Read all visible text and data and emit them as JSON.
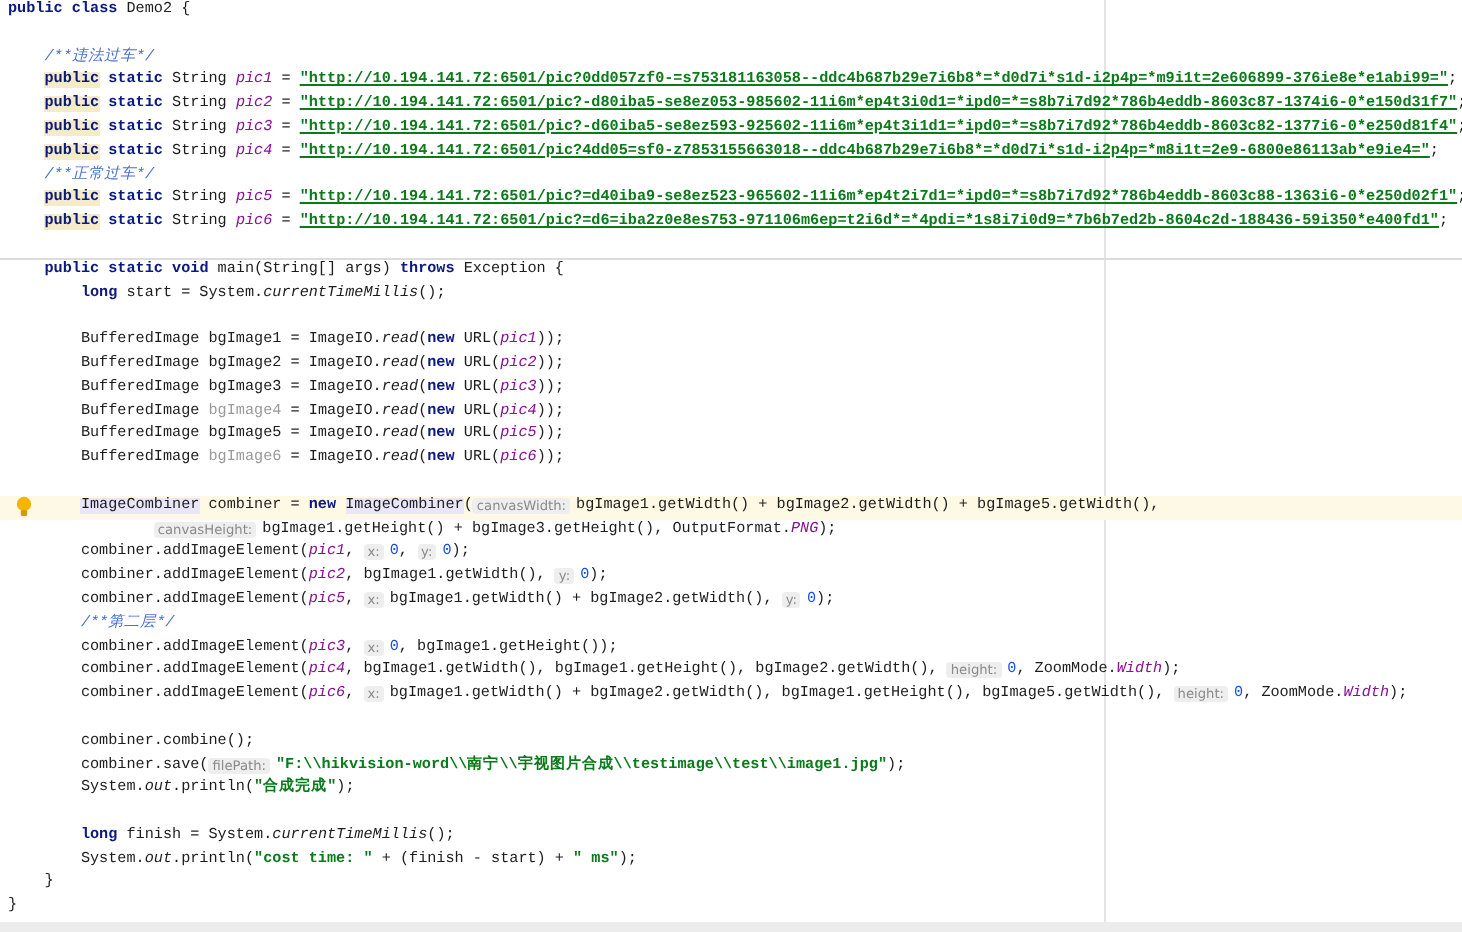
{
  "editor": {
    "lines": [
      {
        "kind": "code",
        "tokens": [
          {
            "kind": "kw",
            "text": "public class"
          },
          {
            "kind": "plain",
            "text": " Demo2 {"
          }
        ],
        "children": [
          {
            "kind": "blank"
          },
          {
            "kind": "code",
            "tokens": [
              {
                "kind": "comment",
                "text": "/**违法过车*/"
              }
            ]
          },
          {
            "kind": "code",
            "tokens": [
              {
                "kind": "kw_warn",
                "text": "public"
              },
              {
                "kind": "kw",
                "text": " static"
              },
              {
                "kind": "plain",
                "text": " String "
              },
              {
                "kind": "field",
                "text": "pic1"
              },
              {
                "kind": "plain",
                "text": " = "
              },
              {
                "kind": "url",
                "text": "\"http://10.194.141.72:6501/pic?0dd057zf0-=s753181163058--ddc4b687b29e7i6b8*=*d0d7i*s1d-i2p4p=*m9i1t=2e606899-376ie8e*e1abi99=\""
              },
              {
                "kind": "plain",
                "text": ";"
              }
            ]
          },
          {
            "kind": "code",
            "tokens": [
              {
                "kind": "kw_warn",
                "text": "public"
              },
              {
                "kind": "kw",
                "text": " static"
              },
              {
                "kind": "plain",
                "text": " String "
              },
              {
                "kind": "field",
                "text": "pic2"
              },
              {
                "kind": "plain",
                "text": " = "
              },
              {
                "kind": "url",
                "text": "\"http://10.194.141.72:6501/pic?-d80iba5-se8ez053-985602-11i6m*ep4t3i0d1=*ipd0=*=s8b7i7d92*786b4eddb-8603c87-1374i6-0*e150d31f7\""
              },
              {
                "kind": "plain",
                "text": ";"
              }
            ]
          },
          {
            "kind": "code",
            "tokens": [
              {
                "kind": "kw_warn",
                "text": "public"
              },
              {
                "kind": "kw",
                "text": " static"
              },
              {
                "kind": "plain",
                "text": " String "
              },
              {
                "kind": "field",
                "text": "pic3"
              },
              {
                "kind": "plain",
                "text": " = "
              },
              {
                "kind": "url",
                "text": "\"http://10.194.141.72:6501/pic?-d60iba5-se8ez593-925602-11i6m*ep4t3i1d1=*ipd0=*=s8b7i7d92*786b4eddb-8603c82-1377i6-0*e250d81f4\""
              },
              {
                "kind": "plain",
                "text": ";"
              }
            ]
          },
          {
            "kind": "code",
            "tokens": [
              {
                "kind": "kw_warn",
                "text": "public"
              },
              {
                "kind": "kw",
                "text": " static"
              },
              {
                "kind": "plain",
                "text": " String "
              },
              {
                "kind": "field",
                "text": "pic4"
              },
              {
                "kind": "plain",
                "text": " = "
              },
              {
                "kind": "url",
                "text": "\"http://10.194.141.72:6501/pic?4dd05=sf0-z7853155663018--ddc4b687b29e7i6b8*=*d0d7i*s1d-i2p4p=*m8i1t=2e9-6800e86113ab*e9ie4=\""
              },
              {
                "kind": "plain",
                "text": ";"
              }
            ]
          },
          {
            "kind": "code",
            "tokens": [
              {
                "kind": "comment",
                "text": "/**正常过车*/"
              }
            ]
          },
          {
            "kind": "code",
            "tokens": [
              {
                "kind": "kw_warn",
                "text": "public"
              },
              {
                "kind": "kw",
                "text": " static"
              },
              {
                "kind": "plain",
                "text": " String "
              },
              {
                "kind": "field",
                "text": "pic5"
              },
              {
                "kind": "plain",
                "text": " = "
              },
              {
                "kind": "url",
                "text": "\"http://10.194.141.72:6501/pic?=d40iba9-se8ez523-965602-11i6m*ep4t2i7d1=*ipd0=*=s8b7i7d92*786b4eddb-8603c88-1363i6-0*e250d02f1\""
              },
              {
                "kind": "plain",
                "text": ";"
              }
            ]
          },
          {
            "kind": "code",
            "tokens": [
              {
                "kind": "kw_warn",
                "text": "public"
              },
              {
                "kind": "kw",
                "text": " static"
              },
              {
                "kind": "plain",
                "text": " String "
              },
              {
                "kind": "field",
                "text": "pic6"
              },
              {
                "kind": "plain",
                "text": " = "
              },
              {
                "kind": "url",
                "text": "\"http://10.194.141.72:6501/pic?=d6=iba2z0e8es753-971106m6ep=t2i6d*=*4pdi=*1s8i7i0d9=*7b6b7ed2b-8604c2d-188436-59i350*e400fd1\""
              },
              {
                "kind": "plain",
                "text": ";"
              }
            ]
          },
          {
            "kind": "blank"
          },
          {
            "kind": "method",
            "tokens": [
              {
                "kind": "kw",
                "text": "public static void"
              },
              {
                "kind": "plain",
                "text": " main(String[] args) "
              },
              {
                "kind": "kw",
                "text": "throws"
              },
              {
                "kind": "plain",
                "text": " Exception {"
              }
            ],
            "children": [
              {
                "kind": "code",
                "tokens": [
                  {
                    "kind": "kw",
                    "text": "long"
                  },
                  {
                    "kind": "plain",
                    "text": " start = System."
                  },
                  {
                    "kind": "static",
                    "text": "currentTimeMillis"
                  },
                  {
                    "kind": "plain",
                    "text": "();"
                  }
                ]
              },
              {
                "kind": "blank"
              },
              {
                "kind": "code",
                "tokens": [
                  {
                    "kind": "plain",
                    "text": "BufferedImage bgImage1 = ImageIO."
                  },
                  {
                    "kind": "static",
                    "text": "read"
                  },
                  {
                    "kind": "plain",
                    "text": "("
                  },
                  {
                    "kind": "kw",
                    "text": "new"
                  },
                  {
                    "kind": "plain",
                    "text": " URL("
                  },
                  {
                    "kind": "field",
                    "text": "pic1"
                  },
                  {
                    "kind": "plain",
                    "text": "));"
                  }
                ]
              },
              {
                "kind": "code",
                "tokens": [
                  {
                    "kind": "plain",
                    "text": "BufferedImage bgImage2 = ImageIO."
                  },
                  {
                    "kind": "static",
                    "text": "read"
                  },
                  {
                    "kind": "plain",
                    "text": "("
                  },
                  {
                    "kind": "kw",
                    "text": "new"
                  },
                  {
                    "kind": "plain",
                    "text": " URL("
                  },
                  {
                    "kind": "field",
                    "text": "pic2"
                  },
                  {
                    "kind": "plain",
                    "text": "));"
                  }
                ]
              },
              {
                "kind": "code",
                "tokens": [
                  {
                    "kind": "plain",
                    "text": "BufferedImage bgImage3 = ImageIO."
                  },
                  {
                    "kind": "static",
                    "text": "read"
                  },
                  {
                    "kind": "plain",
                    "text": "("
                  },
                  {
                    "kind": "kw",
                    "text": "new"
                  },
                  {
                    "kind": "plain",
                    "text": " URL("
                  },
                  {
                    "kind": "field",
                    "text": "pic3"
                  },
                  {
                    "kind": "plain",
                    "text": "));"
                  }
                ]
              },
              {
                "kind": "code",
                "tokens": [
                  {
                    "kind": "plain",
                    "text": "BufferedImage "
                  },
                  {
                    "kind": "unused",
                    "text": "bgImage4"
                  },
                  {
                    "kind": "plain",
                    "text": " = ImageIO."
                  },
                  {
                    "kind": "static",
                    "text": "read"
                  },
                  {
                    "kind": "plain",
                    "text": "("
                  },
                  {
                    "kind": "kw",
                    "text": "new"
                  },
                  {
                    "kind": "plain",
                    "text": " URL("
                  },
                  {
                    "kind": "field",
                    "text": "pic4"
                  },
                  {
                    "kind": "plain",
                    "text": "));"
                  }
                ]
              },
              {
                "kind": "code",
                "tokens": [
                  {
                    "kind": "plain",
                    "text": "BufferedImage bgImage5 = ImageIO."
                  },
                  {
                    "kind": "static",
                    "text": "read"
                  },
                  {
                    "kind": "plain",
                    "text": "("
                  },
                  {
                    "kind": "kw",
                    "text": "new"
                  },
                  {
                    "kind": "plain",
                    "text": " URL("
                  },
                  {
                    "kind": "field",
                    "text": "pic5"
                  },
                  {
                    "kind": "plain",
                    "text": "));"
                  }
                ]
              },
              {
                "kind": "code",
                "tokens": [
                  {
                    "kind": "plain",
                    "text": "BufferedImage "
                  },
                  {
                    "kind": "unused",
                    "text": "bgImage6"
                  },
                  {
                    "kind": "plain",
                    "text": " = ImageIO."
                  },
                  {
                    "kind": "static",
                    "text": "read"
                  },
                  {
                    "kind": "plain",
                    "text": "("
                  },
                  {
                    "kind": "kw",
                    "text": "new"
                  },
                  {
                    "kind": "plain",
                    "text": " URL("
                  },
                  {
                    "kind": "field",
                    "text": "pic6"
                  },
                  {
                    "kind": "plain",
                    "text": "));"
                  }
                ]
              },
              {
                "kind": "blank"
              },
              {
                "kind": "current",
                "tokens": [
                  {
                    "kind": "usage",
                    "text": "ImageCombiner"
                  },
                  {
                    "kind": "plain",
                    "text": " combiner = "
                  },
                  {
                    "kind": "kw",
                    "text": "new "
                  },
                  {
                    "kind": "usage",
                    "text": "ImageCombiner"
                  },
                  {
                    "kind": "plain",
                    "text": "("
                  },
                  {
                    "kind": "hint",
                    "text": "canvasWidth:"
                  },
                  {
                    "kind": "plain",
                    "text": "bgImage1.getWidth() + bgImage2.getWidth() + bgImage5.getWidth(),"
                  }
                ]
              },
              {
                "kind": "continuation",
                "tokens": [
                  {
                    "kind": "hint",
                    "text": "canvasHeight:"
                  },
                  {
                    "kind": "plain",
                    "text": "bgImage1.getHeight() + bgImage3.getHeight(), OutputFormat."
                  },
                  {
                    "kind": "field",
                    "text": "PNG"
                  },
                  {
                    "kind": "plain",
                    "text": ");"
                  }
                ]
              },
              {
                "kind": "code",
                "tokens": [
                  {
                    "kind": "plain",
                    "text": "combiner.addImageElement("
                  },
                  {
                    "kind": "field",
                    "text": "pic1"
                  },
                  {
                    "kind": "plain",
                    "text": ", "
                  },
                  {
                    "kind": "hint",
                    "text": "x:"
                  },
                  {
                    "kind": "num",
                    "text": "0"
                  },
                  {
                    "kind": "plain",
                    "text": ", "
                  },
                  {
                    "kind": "hint",
                    "text": "y:"
                  },
                  {
                    "kind": "num",
                    "text": "0"
                  },
                  {
                    "kind": "plain",
                    "text": ");"
                  }
                ]
              },
              {
                "kind": "code",
                "tokens": [
                  {
                    "kind": "plain",
                    "text": "combiner.addImageElement("
                  },
                  {
                    "kind": "field",
                    "text": "pic2"
                  },
                  {
                    "kind": "plain",
                    "text": ", bgImage1.getWidth(), "
                  },
                  {
                    "kind": "hint",
                    "text": "y:"
                  },
                  {
                    "kind": "num",
                    "text": "0"
                  },
                  {
                    "kind": "plain",
                    "text": ");"
                  }
                ]
              },
              {
                "kind": "code",
                "tokens": [
                  {
                    "kind": "plain",
                    "text": "combiner.addImageElement("
                  },
                  {
                    "kind": "field",
                    "text": "pic5"
                  },
                  {
                    "kind": "plain",
                    "text": ", "
                  },
                  {
                    "kind": "hint",
                    "text": "x:"
                  },
                  {
                    "kind": "plain",
                    "text": "bgImage1.getWidth() + bgImage2.getWidth(), "
                  },
                  {
                    "kind": "hint",
                    "text": "y:"
                  },
                  {
                    "kind": "num",
                    "text": "0"
                  },
                  {
                    "kind": "plain",
                    "text": ");"
                  }
                ]
              },
              {
                "kind": "code",
                "tokens": [
                  {
                    "kind": "comment",
                    "text": "/**第二层*/"
                  }
                ]
              },
              {
                "kind": "code",
                "tokens": [
                  {
                    "kind": "plain",
                    "text": "combiner.addImageElement("
                  },
                  {
                    "kind": "field",
                    "text": "pic3"
                  },
                  {
                    "kind": "plain",
                    "text": ", "
                  },
                  {
                    "kind": "hint",
                    "text": "x:"
                  },
                  {
                    "kind": "num",
                    "text": "0"
                  },
                  {
                    "kind": "plain",
                    "text": ", bgImage1.getHeight());"
                  }
                ]
              },
              {
                "kind": "code",
                "tokens": [
                  {
                    "kind": "plain",
                    "text": "combiner.addImageElement("
                  },
                  {
                    "kind": "field",
                    "text": "pic4"
                  },
                  {
                    "kind": "plain",
                    "text": ", bgImage1.getWidth(), bgImage1.getHeight(), bgImage2.getWidth(), "
                  },
                  {
                    "kind": "hint",
                    "text": "height:"
                  },
                  {
                    "kind": "num",
                    "text": "0"
                  },
                  {
                    "kind": "plain",
                    "text": ", ZoomMode."
                  },
                  {
                    "kind": "field",
                    "text": "Width"
                  },
                  {
                    "kind": "plain",
                    "text": ");"
                  }
                ]
              },
              {
                "kind": "code",
                "tokens": [
                  {
                    "kind": "plain",
                    "text": "combiner.addImageElement("
                  },
                  {
                    "kind": "field",
                    "text": "pic6"
                  },
                  {
                    "kind": "plain",
                    "text": ", "
                  },
                  {
                    "kind": "hint",
                    "text": "x:"
                  },
                  {
                    "kind": "plain",
                    "text": "bgImage1.getWidth() + bgImage2.getWidth(), bgImage1.getHeight(), bgImage5.getWidth(), "
                  },
                  {
                    "kind": "hint",
                    "text": "height:"
                  },
                  {
                    "kind": "num",
                    "text": "0"
                  },
                  {
                    "kind": "plain",
                    "text": ", ZoomMode."
                  },
                  {
                    "kind": "field",
                    "text": "Width"
                  },
                  {
                    "kind": "plain",
                    "text": ");"
                  }
                ]
              },
              {
                "kind": "blank"
              },
              {
                "kind": "code",
                "tokens": [
                  {
                    "kind": "plain",
                    "text": "combiner.combine();"
                  }
                ]
              },
              {
                "kind": "code",
                "tokens": [
                  {
                    "kind": "plain",
                    "text": "combiner.save("
                  },
                  {
                    "kind": "hint",
                    "text": "filePath:"
                  },
                  {
                    "kind": "str",
                    "text": "\"F:\\\\hikvision-word\\\\南宁\\\\宇视图片合成\\\\testimage\\\\test\\\\image1.jpg\""
                  },
                  {
                    "kind": "plain",
                    "text": ");"
                  }
                ]
              },
              {
                "kind": "code",
                "tokens": [
                  {
                    "kind": "plain",
                    "text": "System."
                  },
                  {
                    "kind": "static",
                    "text": "out"
                  },
                  {
                    "kind": "plain",
                    "text": ".println("
                  },
                  {
                    "kind": "str",
                    "text": "\"合成完成\""
                  },
                  {
                    "kind": "plain",
                    "text": ");"
                  }
                ]
              },
              {
                "kind": "blank"
              },
              {
                "kind": "code",
                "tokens": [
                  {
                    "kind": "kw",
                    "text": "long"
                  },
                  {
                    "kind": "plain",
                    "text": " finish = System."
                  },
                  {
                    "kind": "static",
                    "text": "currentTimeMillis"
                  },
                  {
                    "kind": "plain",
                    "text": "();"
                  }
                ]
              },
              {
                "kind": "code",
                "tokens": [
                  {
                    "kind": "plain",
                    "text": "System."
                  },
                  {
                    "kind": "static",
                    "text": "out"
                  },
                  {
                    "kind": "plain",
                    "text": ".println("
                  },
                  {
                    "kind": "str",
                    "text": "\"cost time: \""
                  },
                  {
                    "kind": "plain",
                    "text": " + (finish - start) + "
                  },
                  {
                    "kind": "str",
                    "text": "\" ms\""
                  },
                  {
                    "kind": "plain",
                    "text": ");"
                  }
                ]
              }
            ]
          },
          {
            "kind": "code",
            "tokens": [
              {
                "kind": "plain",
                "text": "}"
              }
            ]
          }
        ]
      },
      {
        "kind": "code",
        "tokens": [
          {
            "kind": "plain",
            "text": "}"
          }
        ]
      }
    ]
  }
}
